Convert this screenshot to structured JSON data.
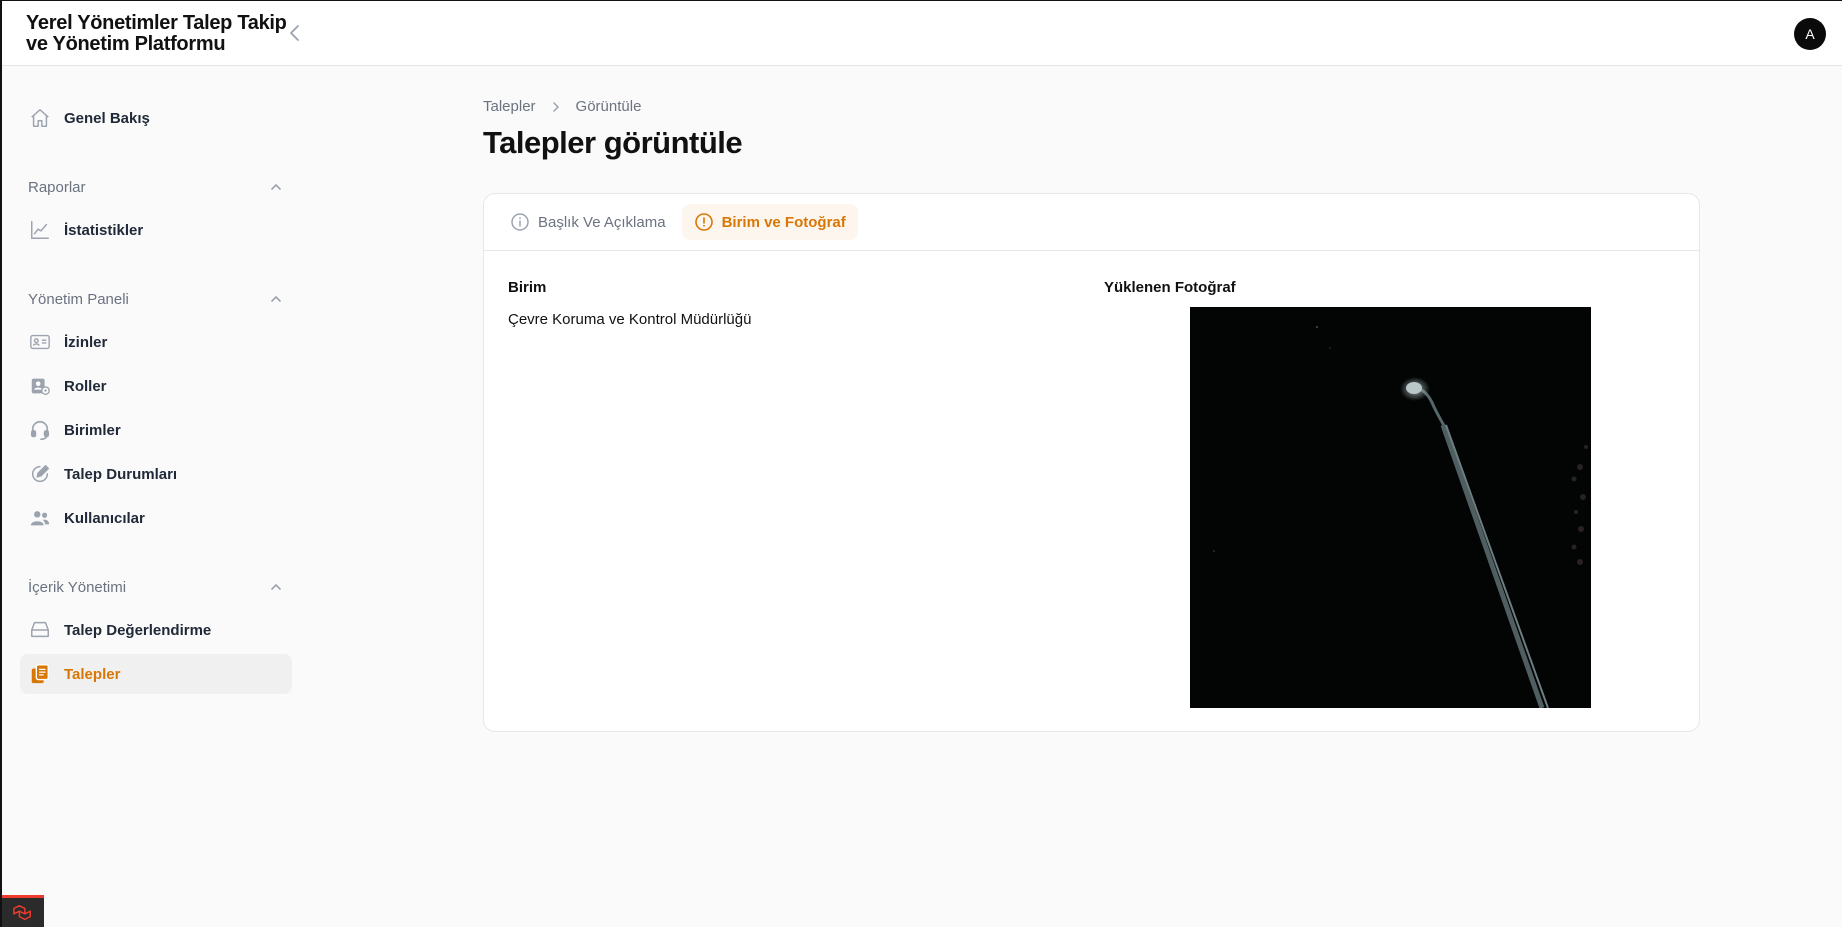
{
  "app": {
    "title": "Yerel Yönetimler Talep Takip ve Yönetim Platformu",
    "avatar_initial": "A"
  },
  "icons": {
    "collapse": "chevron-left-icon",
    "home": "home-icon",
    "chart": "chart-line-icon",
    "id-card": "id-card-icon",
    "roles": "user-roles-icon",
    "headset": "headset-icon",
    "status": "status-edit-icon",
    "users": "users-icon",
    "inbox": "inbox-icon",
    "documents": "documents-icon",
    "info": "info-circle-icon"
  },
  "colors": {
    "accent": "#d97706",
    "text": "#111827",
    "muted": "#6b7280"
  },
  "sidebar": {
    "home_label": "Genel Bakış",
    "groups": [
      {
        "label": "Raporlar",
        "items": [
          {
            "label": "İstatistikler"
          }
        ]
      },
      {
        "label": "Yönetim Paneli",
        "items": [
          {
            "label": "İzinler"
          },
          {
            "label": "Roller"
          },
          {
            "label": "Birimler"
          },
          {
            "label": "Talep Durumları"
          },
          {
            "label": "Kullanıcılar"
          }
        ]
      },
      {
        "label": "İçerik Yönetimi",
        "items": [
          {
            "label": "Talep Değerlendirme"
          },
          {
            "label": "Talepler",
            "active": true
          }
        ]
      }
    ]
  },
  "breadcrumb": {
    "items": [
      "Talepler",
      "Görüntüle"
    ]
  },
  "page": {
    "title": "Talepler görüntüle"
  },
  "tabs": [
    {
      "label": "Başlık Ve Açıklama",
      "active": false
    },
    {
      "label": "Birim ve Fotoğraf",
      "active": true
    }
  ],
  "content": {
    "unit_label": "Birim",
    "unit_value": "Çevre Koruma ve Kontrol Müdürlüğü",
    "photo_label": "Yüklenen Fotoğraf"
  }
}
